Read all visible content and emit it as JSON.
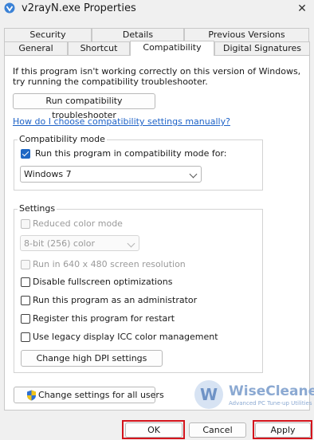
{
  "window": {
    "title": "v2rayN.exe Properties"
  },
  "tabs_row1": [
    "Security",
    "Details",
    "Previous Versions"
  ],
  "tabs_row2": [
    "General",
    "Shortcut",
    "Compatibility",
    "Digital Signatures"
  ],
  "active_tab": "Compatibility",
  "intro": {
    "line1": "If this program isn't working correctly on this version of Windows,",
    "line2": "try running the compatibility troubleshooter."
  },
  "troubleshooter_button": "Run compatibility troubleshooter",
  "help_link": "How do I choose compatibility settings manually?",
  "compat_mode": {
    "group_label": "Compatibility mode",
    "checkbox_label": "Run this program in compatibility mode for:",
    "checked": true,
    "os_selected": "Windows 7"
  },
  "settings": {
    "group_label": "Settings",
    "reduced_color": {
      "label": "Reduced color mode",
      "checked": false,
      "disabled": true
    },
    "color_selected": "8-bit (256) color",
    "res_640": {
      "label": "Run in 640 x 480 screen resolution",
      "checked": false,
      "disabled": true
    },
    "fullscreen_opt": {
      "label": "Disable fullscreen optimizations",
      "checked": false
    },
    "run_as_admin": {
      "label": "Run this program as an administrator",
      "checked": false
    },
    "restart_reg": {
      "label": "Register this program for restart",
      "checked": false
    },
    "legacy_icc": {
      "label": "Use legacy display ICC color management",
      "checked": false
    },
    "dpi_button": "Change high DPI settings"
  },
  "all_users_button": "Change settings for all users",
  "footer": {
    "ok": "OK",
    "cancel": "Cancel",
    "apply": "Apply"
  },
  "watermark": {
    "logo_letter": "W",
    "name": "WiseCleaner",
    "tagline": "Advanced PC Tune-up Utilities"
  },
  "colors": {
    "accent": "#1e67c4",
    "link": "#1d62c7",
    "highlight_box": "#d4141c"
  }
}
